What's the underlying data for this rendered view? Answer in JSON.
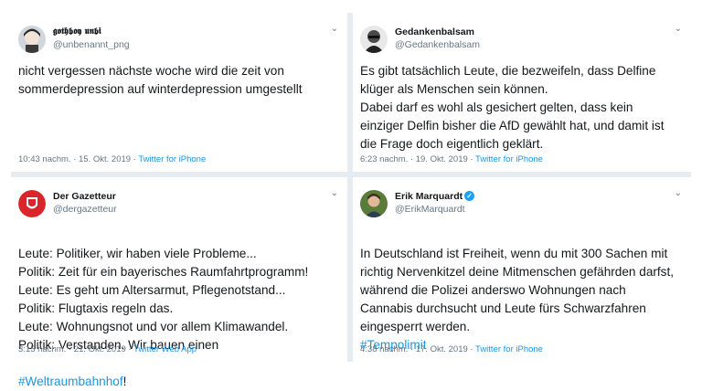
{
  "tweets": [
    {
      "display_name": "𝖌𝖔𝖙𝖍𝖇𝖔𝖞 𝖚𝖓𝖇𝖎",
      "handle": "@unbenannt_png",
      "text": "nicht vergessen nächste woche wird die zeit von sommerdepression auf winterdepression umgestellt",
      "time": "10:43 nachm. · 15. Okt. 2019 · ",
      "source": "Twitter for iPhone",
      "avatar_icon": "anime-avatar-icon"
    },
    {
      "display_name": "Gedankenbalsam",
      "handle": "@Gedankenbalsam",
      "text": "Es gibt tatsächlich Leute, die bezweifeln, dass Delfine klüger als Menschen sein können.\nDabei darf es wohl als gesichert gelten, dass kein einziger Delfin bisher die AfD gewählt hat, und damit ist die Frage doch eigentlich geklärt.",
      "time": "6:23 nachm. · 19. Okt. 2019 · ",
      "source": "Twitter for iPhone",
      "avatar_icon": "bw-portrait-avatar-icon"
    },
    {
      "display_name": "Der Gazetteur",
      "handle": "@dergazetteur",
      "text": "Leute: Politiker, wir haben viele Probleme...\nPolitik: Zeit für ein bayerisches Raumfahrtprogramm!\nLeute: Es geht um Altersarmut, Pflegenotstand...\nPolitik: Flugtaxis regeln das.\nLeute: Wohnungsnot und vor allem Klimawandel.\nPolitik: Verstanden. Wir bauen einen",
      "hashtag": "#Weltraumbahnhof",
      "hashtag_suffix": "!",
      "time": "3:15 nachm. · 21. Okt. 2019 · ",
      "source": "Twitter Web App",
      "avatar_icon": "red-crest-avatar-icon"
    },
    {
      "display_name": "Erik Marquardt",
      "handle": "@ErikMarquardt",
      "verified": "✓",
      "text": "In Deutschland ist Freiheit, wenn du mit 300 Sachen mit richtig Nervenkitzel deine Mitmenschen gefährden darfst, während die Polizei anderswo Wohnungen nach Cannabis durchsucht und Leute fürs Schwarzfahren eingesperrt werden.",
      "hashtag": "#Tempolimit",
      "time": "4:38 nachm. · 17. Okt. 2019 · ",
      "source": "Twitter for iPhone",
      "avatar_icon": "portrait-avatar-icon"
    }
  ],
  "chevron": "⌄",
  "colors": {
    "link": "#1b95e0",
    "muted": "#657786",
    "divider": "#e6ecf0"
  }
}
